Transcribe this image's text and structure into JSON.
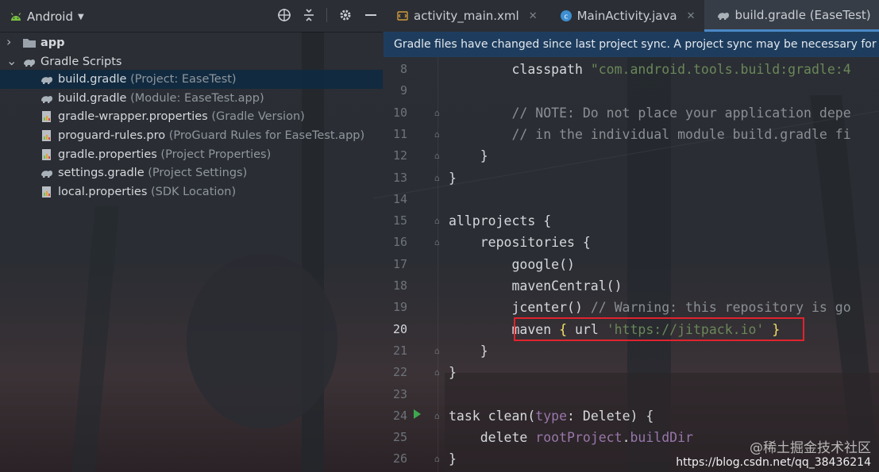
{
  "project_panel": {
    "view_label": "Android",
    "tree": [
      {
        "name": "app",
        "hint": "",
        "kind": "folder",
        "depth": 0,
        "expanded": false
      },
      {
        "name": "Gradle Scripts",
        "hint": "",
        "kind": "gradle-group",
        "depth": 0,
        "expanded": true
      },
      {
        "name": "build.gradle",
        "hint": " (Project: EaseTest)",
        "kind": "gradle",
        "depth": 1,
        "selected": true
      },
      {
        "name": "build.gradle",
        "hint": " (Module: EaseTest.app)",
        "kind": "gradle",
        "depth": 1
      },
      {
        "name": "gradle-wrapper.properties",
        "hint": " (Gradle Version)",
        "kind": "properties",
        "depth": 1
      },
      {
        "name": "proguard-rules.pro",
        "hint": " (ProGuard Rules for EaseTest.app)",
        "kind": "properties",
        "depth": 1
      },
      {
        "name": "gradle.properties",
        "hint": " (Project Properties)",
        "kind": "properties",
        "depth": 1
      },
      {
        "name": "settings.gradle",
        "hint": " (Project Settings)",
        "kind": "gradle",
        "depth": 1
      },
      {
        "name": "local.properties",
        "hint": " (SDK Location)",
        "kind": "properties",
        "depth": 1
      }
    ]
  },
  "editor": {
    "tabs": [
      {
        "label": "activity_main.xml",
        "icon": "xml-file-icon",
        "active": false
      },
      {
        "label": "MainActivity.java",
        "icon": "java-class-icon",
        "active": false
      },
      {
        "label": "build.gradle (EaseTest)",
        "icon": "gradle-icon",
        "active": true
      }
    ],
    "banner": "Gradle files have changed since last project sync. A project sync may be necessary for the IDE to work properly.",
    "highlighted_line": 20,
    "lines": [
      {
        "n": "8",
        "segs": [
          {
            "t": "        classpath ",
            "c": "kw"
          },
          {
            "t": "\"com.android.tools.build:gradle:4",
            "c": "str"
          }
        ]
      },
      {
        "n": "9",
        "segs": []
      },
      {
        "n": "10",
        "segs": [
          {
            "t": "        // NOTE: Do not place your application depe",
            "c": "cmt"
          }
        ]
      },
      {
        "n": "11",
        "segs": [
          {
            "t": "        // in the individual module build.gradle fi",
            "c": "cmt"
          }
        ]
      },
      {
        "n": "12",
        "segs": [
          {
            "t": "    }",
            "c": "kw"
          }
        ]
      },
      {
        "n": "13",
        "segs": [
          {
            "t": "}",
            "c": "kw"
          }
        ]
      },
      {
        "n": "14",
        "segs": []
      },
      {
        "n": "15",
        "segs": [
          {
            "t": "allprojects {",
            "c": "kw"
          }
        ]
      },
      {
        "n": "16",
        "segs": [
          {
            "t": "    repositories {",
            "c": "kw"
          }
        ]
      },
      {
        "n": "17",
        "segs": [
          {
            "t": "        google()",
            "c": "kw"
          }
        ]
      },
      {
        "n": "18",
        "segs": [
          {
            "t": "        mavenCentral()",
            "c": "kw"
          }
        ]
      },
      {
        "n": "19",
        "segs": [
          {
            "t": "        jcenter() ",
            "c": "kw"
          },
          {
            "t": "// Warning: this repository is go",
            "c": "cmt"
          }
        ]
      },
      {
        "n": "20",
        "segs": [
          {
            "t": "        maven ",
            "c": "kw"
          },
          {
            "t": "{",
            "c": "br"
          },
          {
            "t": " url ",
            "c": "kw"
          },
          {
            "t": "'https://jitpack.io'",
            "c": "str"
          },
          {
            "t": " ",
            "c": "kw"
          },
          {
            "t": "}",
            "c": "br"
          }
        ]
      },
      {
        "n": "21",
        "segs": [
          {
            "t": "    }",
            "c": "kw"
          }
        ]
      },
      {
        "n": "22",
        "segs": [
          {
            "t": "}",
            "c": "kw"
          }
        ]
      },
      {
        "n": "23",
        "segs": []
      },
      {
        "n": "24",
        "segs": [
          {
            "t": "task clean(",
            "c": "kw"
          },
          {
            "t": "type",
            "c": "pur"
          },
          {
            "t": ": Delete) {",
            "c": "kw"
          }
        ]
      },
      {
        "n": "25",
        "segs": [
          {
            "t": "    delete ",
            "c": "kw"
          },
          {
            "t": "rootProject",
            "c": "pur"
          },
          {
            "t": ".",
            "c": "kw"
          },
          {
            "t": "buildDir",
            "c": "pur"
          }
        ]
      },
      {
        "n": "26",
        "segs": [
          {
            "t": "}",
            "c": "kw"
          }
        ]
      }
    ]
  },
  "watermark": {
    "line1": "@稀土掘金技术社区",
    "line2": "https://blog.csdn.net/qq_38436214"
  },
  "colors": {
    "accent": "#4a88c7",
    "highlight_box": "#e0232e",
    "string": "#6a8759",
    "comment": "#8a8f94",
    "purple": "#9876aa"
  }
}
